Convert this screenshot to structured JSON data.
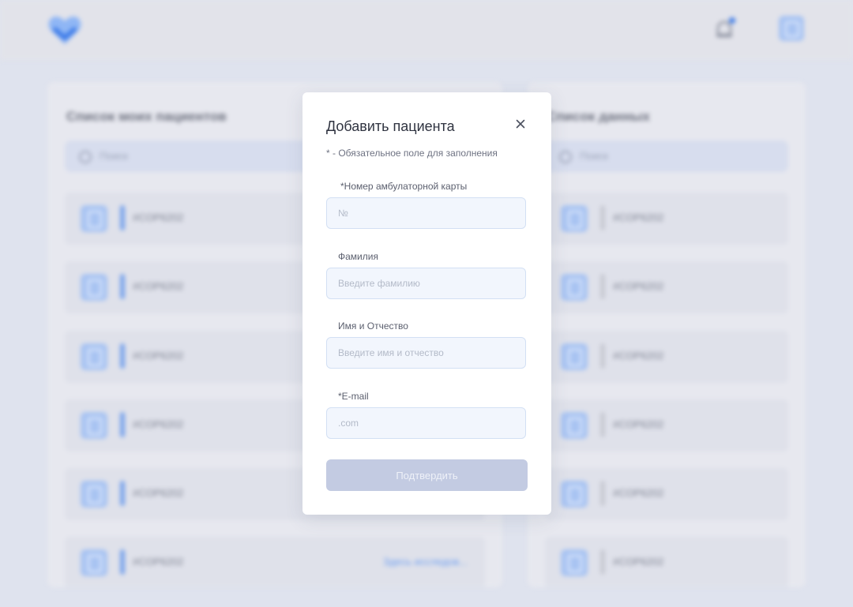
{
  "background": {
    "left_panel": {
      "title": "Список моих пациентов",
      "search_placeholder": "Поиск",
      "rows": [
        {
          "text": "#COP6202",
          "link": ""
        },
        {
          "text": "#COP6202",
          "link": ""
        },
        {
          "text": "#COP6202",
          "link": ""
        },
        {
          "text": "#COP6202",
          "link": ""
        },
        {
          "text": "#COP6202",
          "link": ""
        },
        {
          "text": "#COP6202",
          "link": "Здесь исследов..."
        }
      ]
    },
    "right_panel": {
      "title": "Список данных",
      "search_placeholder": "Поиск",
      "rows": [
        {
          "text": "#COP6202"
        },
        {
          "text": "#COP6202"
        },
        {
          "text": "#COP6202"
        },
        {
          "text": "#COP6202"
        },
        {
          "text": "#COP6202"
        },
        {
          "text": "#COP6202"
        }
      ]
    }
  },
  "modal": {
    "title": "Добавить пациента",
    "required_note": "* - Обязательное поле для заполнения",
    "fields": [
      {
        "label": "*Номер амбулаторной карты",
        "placeholder": "№",
        "value": ""
      },
      {
        "label": "Фамилия",
        "placeholder": "Введите фамилию",
        "value": ""
      },
      {
        "label": "Имя и Отчество",
        "placeholder": "Введите имя и отчество",
        "value": ""
      },
      {
        "label": "*E-mail",
        "placeholder": ".com",
        "value": ""
      }
    ],
    "submit_label": "Подтвердить"
  },
  "icons": {
    "logo": "heart-logo-icon",
    "notifications": "bell-icon",
    "profile": "user-avatar-icon",
    "close": "close-icon",
    "search": "search-icon"
  },
  "colors": {
    "accent": "#3d7be8",
    "button_disabled": "#c3cbe2",
    "input_bg": "#f2f6fd"
  }
}
